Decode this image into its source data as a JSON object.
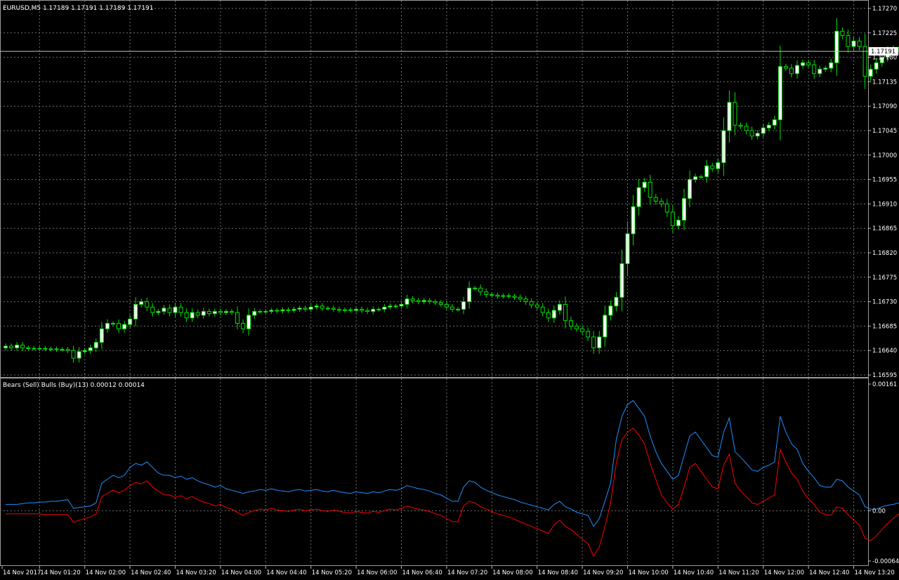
{
  "main_chart": {
    "header": "EURUSD,M5  1.17189 1.17191 1.17189 1.17191",
    "current_price_label": "1.17191",
    "price_ticks": [
      "1.17270",
      "1.17225",
      "1.17180",
      "1.17135",
      "1.17090",
      "1.17045",
      "1.17000",
      "1.16955",
      "1.16910",
      "1.16865",
      "1.16820",
      "1.16775",
      "1.16730",
      "1.16685",
      "1.16640",
      "1.16595"
    ]
  },
  "indicator": {
    "header": "Bears (Sell) Bulls (Buy)(13) 0.00012 0.00014",
    "ticks": [
      "0.00161",
      "0.00",
      "-0.00064"
    ]
  },
  "time_labels": [
    "14 Nov 2017",
    "14 Nov 01:20",
    "14 Nov 02:00",
    "14 Nov 02:40",
    "14 Nov 03:20",
    "14 Nov 04:00",
    "14 Nov 04:40",
    "14 Nov 05:20",
    "14 Nov 06:00",
    "14 Nov 06:40",
    "14 Nov 07:20",
    "14 Nov 08:00",
    "14 Nov 08:40",
    "14 Nov 09:20",
    "14 Nov 10:00",
    "14 Nov 10:40",
    "14 Nov 11:20",
    "14 Nov 12:00",
    "14 Nov 12:40",
    "14 Nov 13:20"
  ],
  "colors": {
    "background": "#000000",
    "grid": "#707070",
    "bull_candle": "#ffffff",
    "bear_candle": "#000000",
    "wick": "#00e000",
    "bulls_line": "#1e90ff",
    "bears_line": "#ff0000",
    "axis_text": "#ffffff"
  },
  "chart_data": [
    {
      "type": "candlestick",
      "title": "EURUSD,M5",
      "ylim": [
        1.16595,
        1.1727
      ],
      "current": 1.17191,
      "x": [
        "00:10",
        "00:15",
        "00:20",
        "00:25",
        "00:30",
        "00:35",
        "00:40",
        "00:45",
        "00:50",
        "00:55",
        "01:00",
        "01:05",
        "01:10",
        "01:15",
        "01:20",
        "01:25",
        "01:30",
        "01:35",
        "01:40",
        "01:45",
        "01:50",
        "01:55",
        "02:00",
        "02:05",
        "02:10",
        "02:15",
        "02:20",
        "02:25",
        "02:30",
        "02:35",
        "02:40",
        "02:45",
        "02:50",
        "02:55",
        "03:00",
        "03:05",
        "03:10",
        "03:15",
        "03:20",
        "03:25",
        "03:30",
        "03:35",
        "03:40",
        "03:45",
        "03:50",
        "03:55",
        "04:00",
        "04:05",
        "04:10",
        "04:15",
        "04:20",
        "04:25",
        "04:30",
        "04:35",
        "04:40",
        "04:45",
        "04:50",
        "04:55",
        "05:00",
        "05:05",
        "05:10",
        "05:15",
        "05:20",
        "05:25",
        "05:30",
        "05:35",
        "05:40",
        "05:45",
        "05:50",
        "05:55",
        "06:00",
        "06:05",
        "06:10",
        "06:15",
        "06:20",
        "06:25",
        "06:30",
        "06:35",
        "06:40",
        "06:45",
        "06:50",
        "06:55",
        "07:00",
        "07:05",
        "07:10",
        "07:15",
        "07:20",
        "07:25",
        "07:30",
        "07:35",
        "07:40",
        "07:45",
        "07:50",
        "07:55",
        "08:00",
        "08:05",
        "08:10",
        "08:15",
        "08:20",
        "08:25",
        "08:30",
        "08:35",
        "08:40",
        "08:45",
        "08:50",
        "08:55",
        "09:00",
        "09:05",
        "09:10",
        "09:15",
        "09:20",
        "09:25",
        "09:30",
        "09:35",
        "09:40",
        "09:45",
        "09:50",
        "09:55",
        "10:00",
        "10:05",
        "10:10",
        "10:15",
        "10:20",
        "10:25",
        "10:30",
        "10:35",
        "10:40",
        "10:45",
        "10:50",
        "10:55",
        "11:00",
        "11:05",
        "11:10",
        "11:15",
        "11:20",
        "11:25",
        "11:30",
        "11:35",
        "11:40",
        "11:45",
        "11:50",
        "11:55",
        "12:00",
        "12:05",
        "12:10",
        "12:15",
        "12:20",
        "12:25",
        "12:30",
        "12:35",
        "12:40",
        "12:45",
        "12:50",
        "12:55",
        "13:00",
        "13:05",
        "13:10",
        "13:15",
        "13:20"
      ],
      "close": [
        1.16648,
        1.16645,
        1.1665,
        1.16645,
        1.16644,
        1.16644,
        1.16644,
        1.16643,
        1.16643,
        1.16642,
        1.16642,
        1.1664,
        1.16626,
        1.16638,
        1.1664,
        1.16645,
        1.16655,
        1.1668,
        1.1669,
        1.1669,
        1.1668,
        1.16688,
        1.16698,
        1.16725,
        1.1673,
        1.1672,
        1.1671,
        1.16712,
        1.16718,
        1.1671,
        1.1672,
        1.1671,
        1.167,
        1.1671,
        1.16705,
        1.16712,
        1.16708,
        1.16712,
        1.1671,
        1.16712,
        1.1671,
        1.1669,
        1.1668,
        1.16705,
        1.16712,
        1.16712,
        1.16712,
        1.16714,
        1.16713,
        1.16715,
        1.16714,
        1.16716,
        1.16718,
        1.16716,
        1.1672,
        1.16722,
        1.16718,
        1.16718,
        1.16716,
        1.16714,
        1.16715,
        1.16714,
        1.16716,
        1.16714,
        1.16712,
        1.16716,
        1.16716,
        1.1672,
        1.16722,
        1.16722,
        1.16725,
        1.16735,
        1.16732,
        1.1673,
        1.16732,
        1.1673,
        1.16728,
        1.16725,
        1.1672,
        1.16716,
        1.16716,
        1.1673,
        1.16755,
        1.16755,
        1.16748,
        1.16743,
        1.16742,
        1.1674,
        1.16741,
        1.1674,
        1.16738,
        1.16735,
        1.1673,
        1.16724,
        1.1672,
        1.1671,
        1.167,
        1.16714,
        1.16725,
        1.16695,
        1.16685,
        1.1668,
        1.16675,
        1.16665,
        1.16645,
        1.16665,
        1.16705,
        1.16722,
        1.16738,
        1.168,
        1.16855,
        1.16905,
        1.1694,
        1.1695,
        1.16922,
        1.16915,
        1.1691,
        1.16895,
        1.1687,
        1.1688,
        1.1692,
        1.16955,
        1.1696,
        1.1696,
        1.1698,
        1.16975,
        1.16986,
        1.17045,
        1.17097,
        1.17055,
        1.17053,
        1.17045,
        1.17035,
        1.1704,
        1.1705,
        1.17055,
        1.17065,
        1.17163,
        1.1716,
        1.1715,
        1.17165,
        1.1717,
        1.17166,
        1.1715,
        1.17158,
        1.1716,
        1.1717,
        1.17228,
        1.1722,
        1.172,
        1.1721,
        1.172,
        1.17145,
        1.17158,
        1.1717,
        1.1718,
        1.17192,
        1.17196,
        1.17194,
        1.17198,
        1.17196,
        1.17191
      ]
    },
    {
      "type": "line",
      "title": "Bears (Sell) Bulls (Buy)(13)",
      "ylim": [
        -0.00064,
        0.00161
      ],
      "series": [
        {
          "values": [
            8e-05,
            8e-05,
            8e-05,
            9e-05,
            0.0001,
            0.0001,
            0.00011,
            0.00011,
            0.00012,
            0.00012,
            0.00013,
            0.00014,
            3e-05,
            4e-05,
            5e-05,
            6e-05,
            0.0001,
            0.00035,
            0.0004,
            0.00045,
            0.00042,
            0.00045,
            0.00055,
            0.0006,
            0.00058,
            0.00062,
            0.00055,
            0.00048,
            0.00045,
            0.00045,
            0.00042,
            0.00044,
            0.0004,
            0.00042,
            0.00038,
            0.00035,
            0.00033,
            0.0003,
            0.00032,
            0.00028,
            0.00026,
            0.00024,
            0.00022,
            0.00024,
            0.00025,
            0.00027,
            0.00026,
            0.00028,
            0.00026,
            0.00025,
            0.00024,
            0.00026,
            0.00027,
            0.00025,
            0.00026,
            0.00027,
            0.00025,
            0.00024,
            0.00026,
            0.00024,
            0.00023,
            0.00022,
            0.00024,
            0.00023,
            0.00022,
            0.00024,
            0.00023,
            0.00025,
            0.00027,
            0.00026,
            0.00028,
            0.00032,
            0.0003,
            0.00028,
            0.00027,
            0.00025,
            0.00022,
            0.0002,
            0.00016,
            0.00012,
            0.00012,
            0.0003,
            0.00038,
            0.00036,
            0.0003,
            0.00026,
            0.00023,
            0.0002,
            0.00018,
            0.00016,
            0.00014,
            0.00011,
            9e-05,
            7e-05,
            5e-05,
            3e-05,
            1e-05,
            8e-05,
            0.00012,
            5e-05,
            2e-05,
            -2e-05,
            -4e-05,
            -6e-05,
            -0.0002,
            -0.0001,
            0.00012,
            0.00035,
            0.0009,
            0.0012,
            0.00135,
            0.0014,
            0.0013,
            0.0012,
            0.00095,
            0.00075,
            0.0006,
            0.0005,
            0.0004,
            0.00045,
            0.0007,
            0.00095,
            0.001,
            0.0009,
            0.0008,
            0.0007,
            0.00068,
            0.001,
            0.00118,
            0.00075,
            0.00068,
            0.0006,
            0.00052,
            0.0005,
            0.00055,
            0.00058,
            0.00062,
            0.0012,
            0.001,
            0.00085,
            0.00078,
            0.0006,
            0.0005,
            0.00042,
            0.00032,
            0.0003,
            0.0003,
            0.0004,
            0.00038,
            0.0003,
            0.00025,
            0.0002,
            5e-05,
            2e-05,
            2e-05,
            5e-05,
            7e-05,
            8e-05,
            0.0001,
            0.00012,
            0.00014,
            0.00014
          ]
        },
        {
          "values": [
            -4e-05,
            -4e-05,
            -4e-05,
            -4e-05,
            -4e-05,
            -4e-05,
            -4e-05,
            -5e-05,
            -5e-05,
            -5e-05,
            -5e-05,
            -5e-05,
            -0.00015,
            -0.00012,
            -0.0001,
            -8e-05,
            -4e-05,
            0.00018,
            0.00022,
            0.00026,
            0.00023,
            0.00026,
            0.00032,
            0.00036,
            0.00034,
            0.00038,
            0.0003,
            0.00025,
            0.0002,
            0.0002,
            0.00017,
            0.00019,
            0.00015,
            0.00018,
            0.00014,
            0.00011,
            9e-05,
            6e-05,
            8e-05,
            4e-05,
            2e-05,
            -2e-05,
            -6e-05,
            -2e-05,
            0.0,
            2e-05,
            1e-05,
            3e-05,
            1e-05,
            0.0,
            -1e-05,
            1e-05,
            2e-05,
            0.0,
            1e-05,
            2e-05,
            0.0,
            -1e-05,
            1e-05,
            -1e-05,
            -2e-05,
            -3e-05,
            -1e-05,
            -2e-05,
            -3e-05,
            -1e-05,
            -2e-05,
            0.0,
            2e-05,
            1e-05,
            3e-05,
            6e-05,
            4e-05,
            2e-05,
            1e-05,
            -1e-05,
            -4e-05,
            -6e-05,
            -0.0001,
            -0.00014,
            -0.00014,
            6e-05,
            0.00012,
            0.0001,
            5e-05,
            2e-05,
            -1e-05,
            -4e-05,
            -6e-05,
            -8e-05,
            -0.00011,
            -0.00014,
            -0.00017,
            -0.0002,
            -0.00023,
            -0.00026,
            -0.00029,
            -0.00018,
            -0.00012,
            -0.0002,
            -0.00024,
            -0.0003,
            -0.00036,
            -0.00042,
            -0.00058,
            -0.00046,
            -0.0002,
            0.0001,
            0.0006,
            0.0009,
            0.001,
            0.00105,
            0.00096,
            0.00085,
            0.0006,
            0.0004,
            0.0002,
            0.0001,
            2e-05,
            8e-05,
            0.0003,
            0.00055,
            0.0006,
            0.0005,
            0.0004,
            0.0003,
            0.00028,
            0.00058,
            0.00072,
            0.00035,
            0.00025,
            0.00018,
            0.0001,
            8e-05,
            0.00012,
            0.00016,
            0.0002,
            0.00078,
            0.00062,
            0.00048,
            0.0004,
            0.00025,
            0.00015,
            8e-05,
            -2e-05,
            -5e-05,
            -6e-05,
            5e-05,
            3e-05,
            -5e-05,
            -0.00012,
            -0.00018,
            -0.00035,
            -0.00038,
            -0.00032,
            -0.00024,
            -0.00016,
            -0.0001,
            -4e-05,
            2e-05,
            8e-05,
            0.00012
          ]
        }
      ]
    }
  ]
}
